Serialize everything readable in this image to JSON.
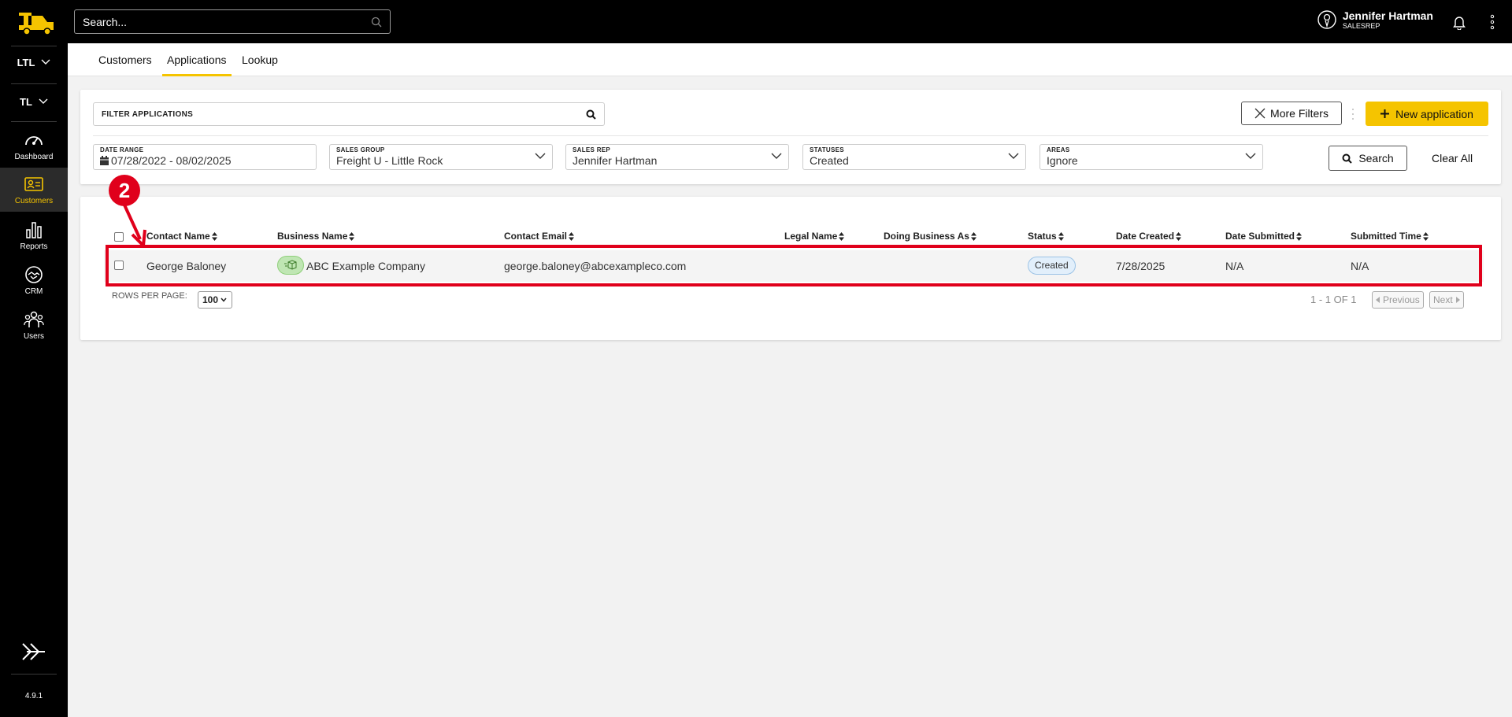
{
  "app": {
    "version": "4.9.1"
  },
  "sidebar": {
    "dropdowns": [
      {
        "label": "LTL"
      },
      {
        "label": "TL"
      }
    ],
    "items": [
      {
        "label": "Dashboard",
        "icon": "gauge-icon"
      },
      {
        "label": "Customers",
        "icon": "id-card-icon",
        "active": true
      },
      {
        "label": "Reports",
        "icon": "bar-chart-icon"
      },
      {
        "label": "CRM",
        "icon": "handshake-icon"
      },
      {
        "label": "Users",
        "icon": "users-icon"
      }
    ]
  },
  "topbar": {
    "search_placeholder": "Search...",
    "user_name": "Jennifer Hartman",
    "user_role": "SALESREP"
  },
  "tabs": [
    {
      "label": "Customers",
      "active": false
    },
    {
      "label": "Applications",
      "active": true
    },
    {
      "label": "Lookup",
      "active": false
    }
  ],
  "filters": {
    "search_placeholder": "FILTER APPLICATIONS",
    "more_filters_label": "More Filters",
    "new_application_label": "New application",
    "date_range": {
      "label": "DATE RANGE",
      "value": "07/28/2022 - 08/02/2025"
    },
    "sales_group": {
      "label": "SALES GROUP",
      "value": "Freight U - Little Rock"
    },
    "sales_rep": {
      "label": "SALES REP",
      "value": "Jennifer Hartman"
    },
    "statuses": {
      "label": "STATUSES",
      "value": "Created"
    },
    "areas": {
      "label": "AREAS",
      "value": "Ignore"
    },
    "search_label": "Search",
    "clear_all_label": "Clear All"
  },
  "table": {
    "columns": [
      "Contact Name",
      "Business Name",
      "Contact Email",
      "Legal Name",
      "Doing Business As",
      "Status",
      "Date Created",
      "Date Submitted",
      "Submitted Time"
    ],
    "rows": [
      {
        "contact_name": "George Baloney",
        "business_name": "ABC Example Company",
        "contact_email": "george.baloney@abcexampleco.com",
        "legal_name": "",
        "dba": "",
        "status": "Created",
        "date_created": "7/28/2025",
        "date_submitted": "N/A",
        "submitted_time": "N/A"
      }
    ],
    "rows_per_page_label": "ROWS PER PAGE:",
    "rows_per_page": "100",
    "page_info": "1 - 1 OF 1",
    "previous_label": "Previous",
    "next_label": "Next"
  },
  "annotation": {
    "step": "2",
    "color": "#e0001b"
  },
  "colors": {
    "accent": "#f5c400",
    "sidebar": "#000000",
    "status_badge": "#e2effb"
  }
}
